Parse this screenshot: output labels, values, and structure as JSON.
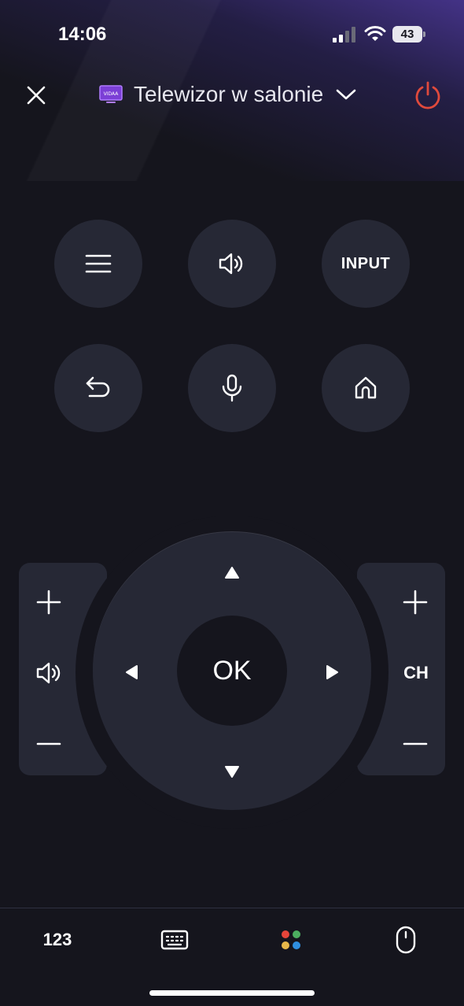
{
  "status_bar": {
    "time": "14:06",
    "battery_level": "43",
    "signal_bars": 2
  },
  "header": {
    "device_name": "Telewizor w salonie",
    "tv_icon_text": "VIDAA",
    "power_color": "#e04a3c"
  },
  "buttons": {
    "input_label": "INPUT",
    "ok_label": "OK",
    "channel_label": "CH"
  },
  "bottom_bar": {
    "numpad_label": "123"
  },
  "colors": {
    "background": "#15151d",
    "button": "#262835",
    "accent_purple": "#9b4dff",
    "dot_red": "#e5453a",
    "dot_green": "#4caf60",
    "dot_yellow": "#e8b84a",
    "dot_blue": "#2f8fe0"
  },
  "icons": [
    "close-icon",
    "tv-icon",
    "chevron-down-icon",
    "power-icon",
    "menu-icon",
    "sound-icon",
    "back-icon",
    "microphone-icon",
    "home-icon",
    "plus-icon",
    "minus-icon",
    "volume-icon",
    "arrow-up-icon",
    "arrow-down-icon",
    "arrow-left-icon",
    "arrow-right-icon",
    "keyboard-icon",
    "color-buttons-icon",
    "mouse-icon"
  ]
}
